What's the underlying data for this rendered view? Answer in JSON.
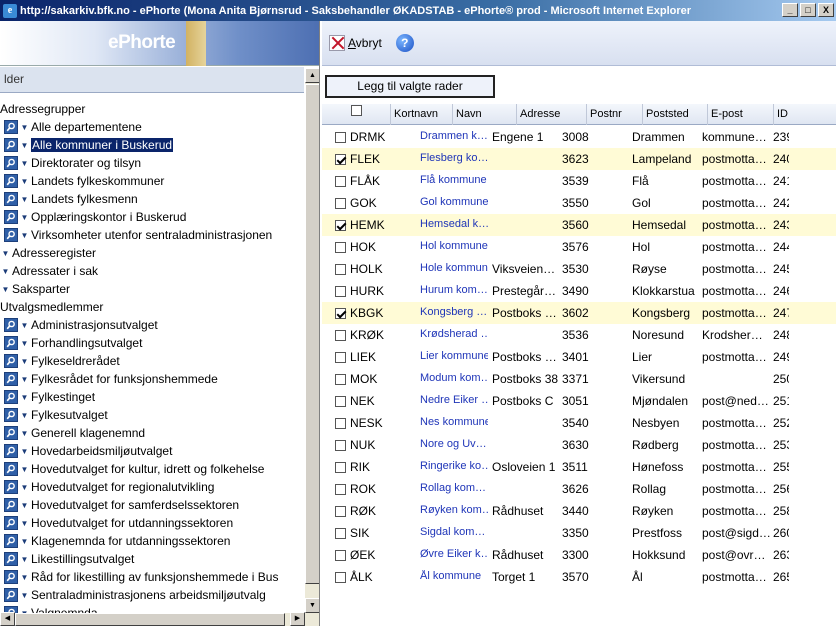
{
  "window": {
    "title": "http://sakarkiv.bfk.no - ePhorte (Mona Anita Bjørnsrud - Saksbehandler ØKADSTAB - ePhorte® prod - Microsoft Internet Explorer",
    "buttons": [
      "_",
      "□",
      "X"
    ]
  },
  "left": {
    "logo": "ePhorte",
    "header": "lder",
    "tree": [
      {
        "label": "Adressegrupper",
        "type": "header"
      },
      {
        "label": "Alle departementene",
        "type": "item"
      },
      {
        "label": "Alle kommuner i Buskerud",
        "type": "item",
        "selected": true
      },
      {
        "label": "Direktorater og tilsyn",
        "type": "item"
      },
      {
        "label": "Landets fylkeskommuner",
        "type": "item"
      },
      {
        "label": "Landets fylkesmenn",
        "type": "item"
      },
      {
        "label": "Opplæringskontor i Buskerud",
        "type": "item"
      },
      {
        "label": "Virksomheter utenfor sentraladministrasjonen",
        "type": "item"
      },
      {
        "label": "Adresseregister",
        "type": "collapsed"
      },
      {
        "label": "Adressater i sak",
        "type": "collapsed"
      },
      {
        "label": "Saksparter",
        "type": "collapsed"
      },
      {
        "label": "Utvalgsmedlemmer",
        "type": "header"
      },
      {
        "label": "Administrasjonsutvalget",
        "type": "item"
      },
      {
        "label": "Forhandlingsutvalget",
        "type": "item"
      },
      {
        "label": "Fylkeseldrerådet",
        "type": "item"
      },
      {
        "label": "Fylkesrådet for funksjonshemmede",
        "type": "item"
      },
      {
        "label": "Fylkestinget",
        "type": "item"
      },
      {
        "label": "Fylkesutvalget",
        "type": "item"
      },
      {
        "label": "Generell klagenemnd",
        "type": "item"
      },
      {
        "label": "Hovedarbeidsmiljøutvalget",
        "type": "item"
      },
      {
        "label": "Hovedutvalget for kultur, idrett og folkehelse",
        "type": "item"
      },
      {
        "label": "Hovedutvalget for regionalutvikling",
        "type": "item"
      },
      {
        "label": "Hovedutvalget for samferdselssektoren",
        "type": "item"
      },
      {
        "label": "Hovedutvalget for utdanningssektoren",
        "type": "item"
      },
      {
        "label": "Klagenemnda for utdanningssektoren",
        "type": "item"
      },
      {
        "label": "Likestillingsutvalget",
        "type": "item"
      },
      {
        "label": "Råd for likestilling av funksjonshemmede i Bus",
        "type": "item"
      },
      {
        "label": "Sentraladministrasjonens arbeidsmiljøutvalg",
        "type": "item"
      },
      {
        "label": "Valgnemnda",
        "type": "item"
      }
    ]
  },
  "toolbar": {
    "cancel_label": "Avbryt",
    "cancel_accesskey": "A",
    "cancel_rest": "vbryt",
    "help_label": "?"
  },
  "add_button": "Legg til valgte rader",
  "columns": [
    "Kortnavn",
    "Navn",
    "Adresse",
    "Postnr",
    "Poststed",
    "E-post",
    "ID"
  ],
  "rows": [
    {
      "checked": false,
      "code": "DRMK",
      "name": "Drammen k…",
      "address": "Engene 1",
      "postnr": "3008",
      "poststed": "Drammen",
      "email": "kommune…",
      "id": "239"
    },
    {
      "checked": true,
      "code": "FLEK",
      "name": "Flesberg ko…",
      "address": "",
      "postnr": "3623",
      "poststed": "Lampeland",
      "email": "postmotta…",
      "id": "240"
    },
    {
      "checked": false,
      "code": "FLÅK",
      "name": "Flå kommune",
      "address": "",
      "postnr": "3539",
      "poststed": "Flå",
      "email": "postmotta…",
      "id": "241"
    },
    {
      "checked": false,
      "code": "GOK",
      "name": "Gol kommune",
      "address": "",
      "postnr": "3550",
      "poststed": "Gol",
      "email": "postmotta…",
      "id": "242"
    },
    {
      "checked": true,
      "code": "HEMK",
      "name": "Hemsedal k…",
      "address": "",
      "postnr": "3560",
      "poststed": "Hemsedal",
      "email": "postmotta…",
      "id": "243"
    },
    {
      "checked": false,
      "code": "HOK",
      "name": "Hol kommune",
      "address": "",
      "postnr": "3576",
      "poststed": "Hol",
      "email": "postmotta…",
      "id": "244"
    },
    {
      "checked": false,
      "code": "HOLK",
      "name": "Hole kommune",
      "address": "Viksveien…",
      "postnr": "3530",
      "poststed": "Røyse",
      "email": "postmotta…",
      "id": "245"
    },
    {
      "checked": false,
      "code": "HURK",
      "name": "Hurum kom…",
      "address": "Prestegår…",
      "postnr": "3490",
      "poststed": "Klokkarstua",
      "email": "postmotta…",
      "id": "246"
    },
    {
      "checked": true,
      "code": "KBGK",
      "name": "Kongsberg …",
      "address": "Postboks …",
      "postnr": "3602",
      "poststed": "Kongsberg",
      "email": "postmotta…",
      "id": "247"
    },
    {
      "checked": false,
      "code": "KRØK",
      "name": "Krødsherad …",
      "address": "",
      "postnr": "3536",
      "poststed": "Noresund",
      "email": "Krodsher…",
      "id": "248"
    },
    {
      "checked": false,
      "code": "LIEK",
      "name": "Lier kommune",
      "address": "Postboks …",
      "postnr": "3401",
      "poststed": "Lier",
      "email": "postmotta…",
      "id": "249"
    },
    {
      "checked": false,
      "code": "MOK",
      "name": "Modum kom…",
      "address": "Postboks 38",
      "postnr": "3371",
      "poststed": "Vikersund",
      "email": "",
      "id": "250"
    },
    {
      "checked": false,
      "code": "NEK",
      "name": "Nedre Eiker …",
      "address": "Postboks C",
      "postnr": "3051",
      "poststed": "Mjøndalen",
      "email": "post@ned…",
      "id": "251"
    },
    {
      "checked": false,
      "code": "NESK",
      "name": "Nes kommune",
      "address": "",
      "postnr": "3540",
      "poststed": "Nesbyen",
      "email": "postmotta…",
      "id": "252"
    },
    {
      "checked": false,
      "code": "NUK",
      "name": "Nore og Uv…",
      "address": "",
      "postnr": "3630",
      "poststed": "Rødberg",
      "email": "postmotta…",
      "id": "253"
    },
    {
      "checked": false,
      "code": "RIK",
      "name": "Ringerike ko…",
      "address": "Osloveien 1",
      "postnr": "3511",
      "poststed": "Hønefoss",
      "email": "postmotta…",
      "id": "255"
    },
    {
      "checked": false,
      "code": "ROK",
      "name": "Rollag kom…",
      "address": "",
      "postnr": "3626",
      "poststed": "Rollag",
      "email": "postmotta…",
      "id": "256"
    },
    {
      "checked": false,
      "code": "RØK",
      "name": "Røyken kom…",
      "address": "Rådhuset",
      "postnr": "3440",
      "poststed": "Røyken",
      "email": "postmotta…",
      "id": "258"
    },
    {
      "checked": false,
      "code": "SIK",
      "name": "Sigdal kom…",
      "address": "",
      "postnr": "3350",
      "poststed": "Prestfoss",
      "email": "post@sigd…",
      "id": "260"
    },
    {
      "checked": false,
      "code": "ØEK",
      "name": "Øvre Eiker k…",
      "address": "Rådhuset",
      "postnr": "3300",
      "poststed": "Hokksund",
      "email": "post@ovr…",
      "id": "263"
    },
    {
      "checked": false,
      "code": "ÅLK",
      "name": "Ål kommune",
      "address": "Torget 1",
      "postnr": "3570",
      "poststed": "Ål",
      "email": "postmotta…",
      "id": "265"
    }
  ],
  "colors": {
    "title_bar": "#0a246a",
    "selected_row": "#fffbd6",
    "link": "#1f35b8",
    "tree_icon": "#2f5fa7"
  },
  "icons": {
    "tree_item": "search-icon",
    "cancel": "cancel-x-icon",
    "help": "help-icon"
  }
}
